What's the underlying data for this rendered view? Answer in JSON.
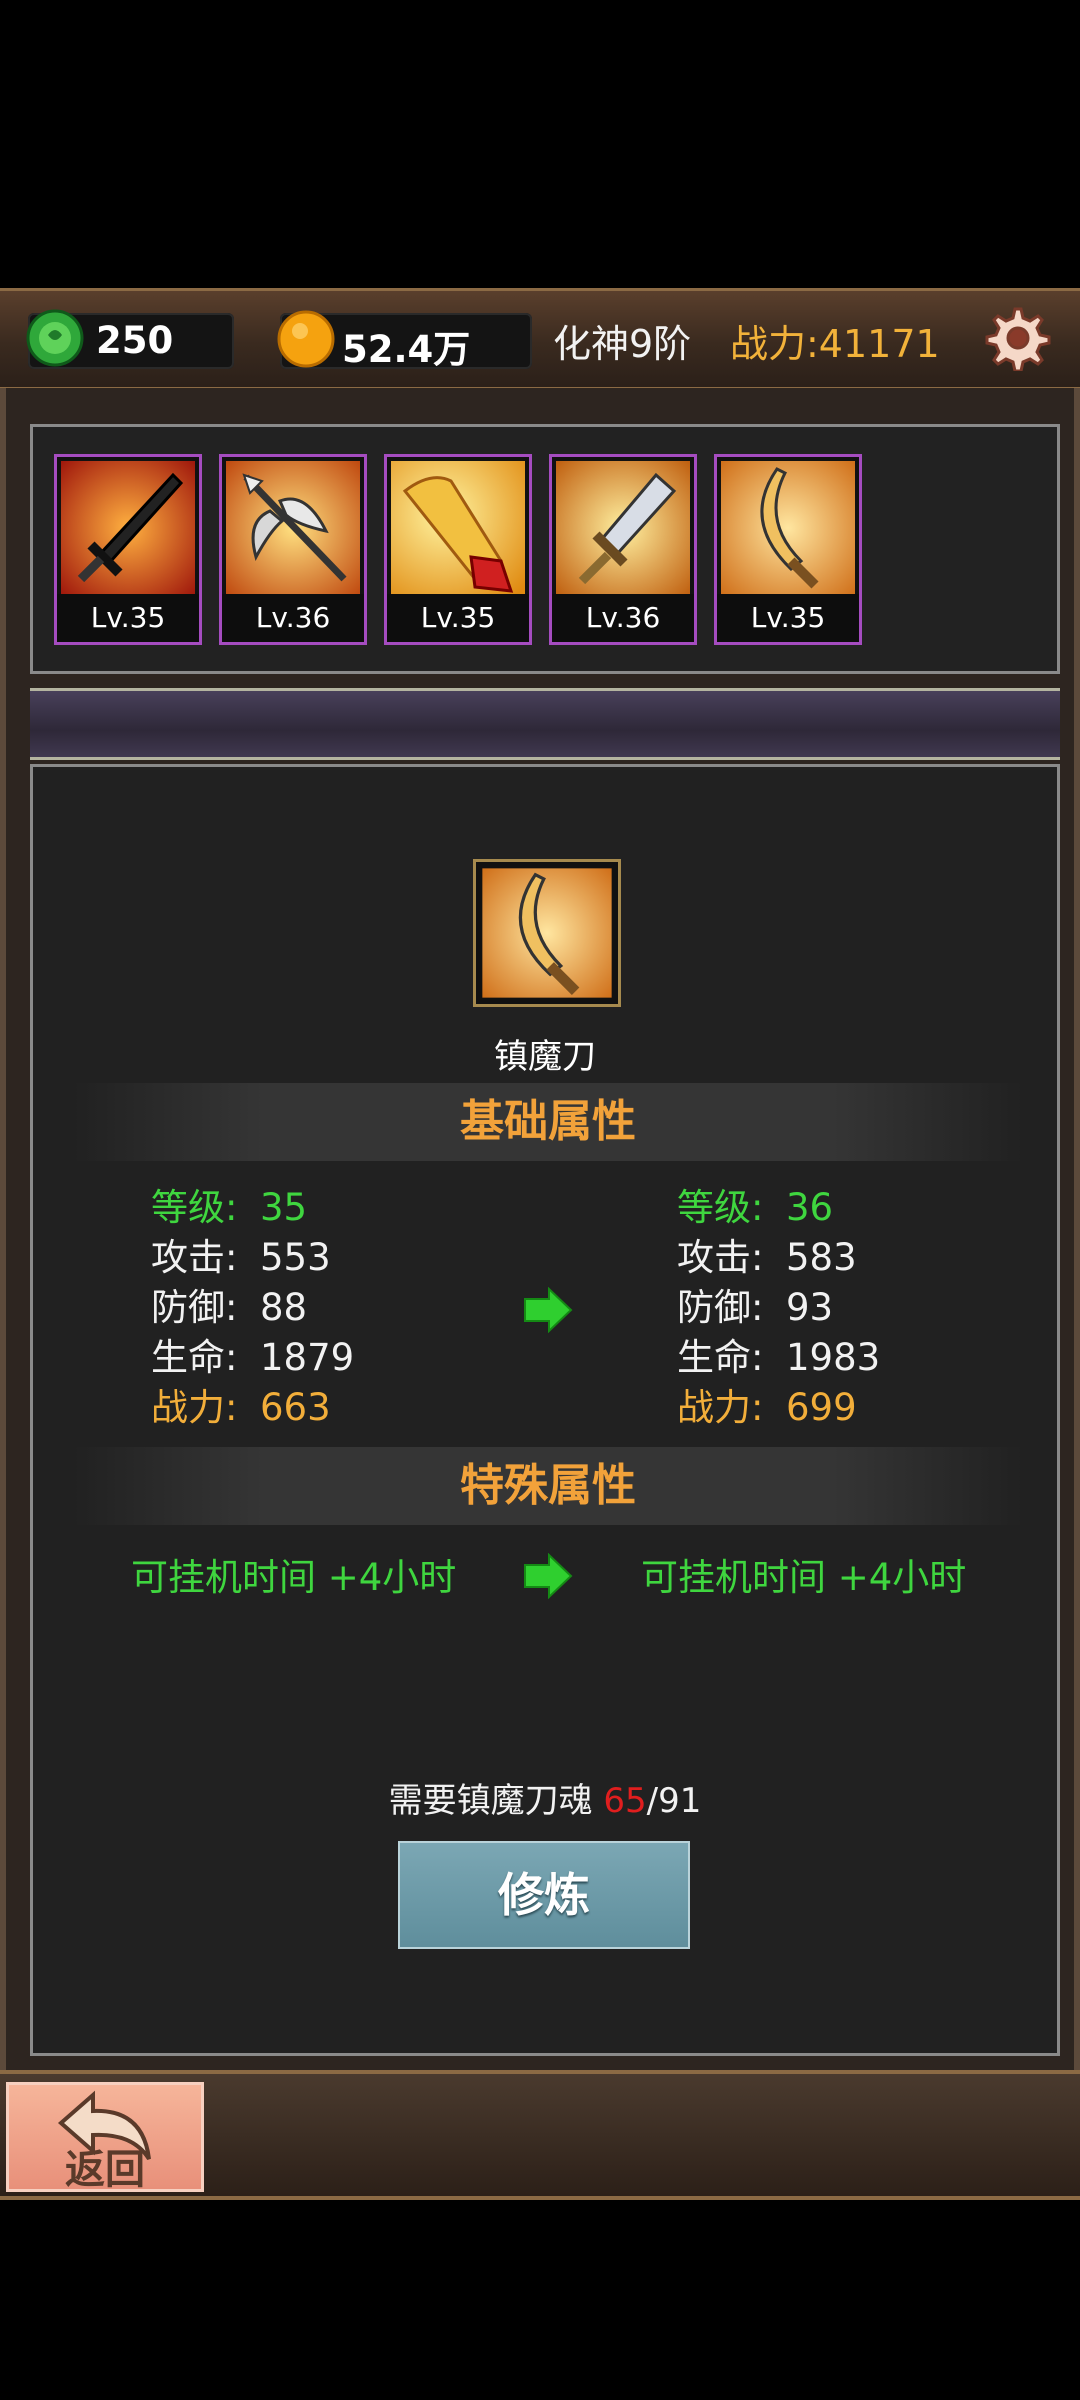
{
  "top_bar": {
    "jade_count": "250",
    "gold_amount": "52.4万",
    "realm": "化神9阶",
    "power": "战力:41171"
  },
  "weapons": [
    {
      "level": "Lv.35",
      "icon": "dark-sword-icon"
    },
    {
      "level": "Lv.36",
      "icon": "halberd-icon"
    },
    {
      "level": "Lv.35",
      "icon": "horn-icon"
    },
    {
      "level": "Lv.36",
      "icon": "broadsword-icon"
    },
    {
      "level": "Lv.35",
      "icon": "curved-blade-icon"
    }
  ],
  "detail": {
    "item_name": "镇魔刀",
    "basic_title": "基础属性",
    "special_title": "特殊属性",
    "current": {
      "level_label": "等级:",
      "level": "35",
      "attack_label": "攻击:",
      "attack": "553",
      "defense_label": "防御:",
      "defense": "88",
      "hp_label": "生命:",
      "hp": "1879",
      "power_label": "战力:",
      "power": "663"
    },
    "next": {
      "level_label": "等级:",
      "level": "36",
      "attack_label": "攻击:",
      "attack": "583",
      "defense_label": "防御:",
      "defense": "93",
      "hp_label": "生命:",
      "hp": "1983",
      "power_label": "战力:",
      "power": "699"
    },
    "special_current": "可挂机时间 +4小时",
    "special_next": "可挂机时间 +4小时",
    "need_prefix": "需要镇魔刀魂 ",
    "need_have": "65",
    "need_total": "/91",
    "train_label": "修炼"
  },
  "bottom": {
    "back_label": "返回"
  },
  "colors": {
    "green": "#3fd63f",
    "orange": "#f2ae3a",
    "red": "#e01e1e",
    "rarity_purple": "#a54cc0"
  }
}
